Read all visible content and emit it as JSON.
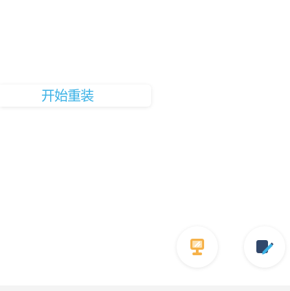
{
  "reinstall": {
    "label": "开始重装"
  },
  "colors": {
    "accent": "#3cb2e6",
    "slate": "#31476a",
    "orange": "#f5a623"
  },
  "icons": {
    "left_fab": "monitor-tool-icon",
    "right_fab": "feedback-pen-icon"
  }
}
